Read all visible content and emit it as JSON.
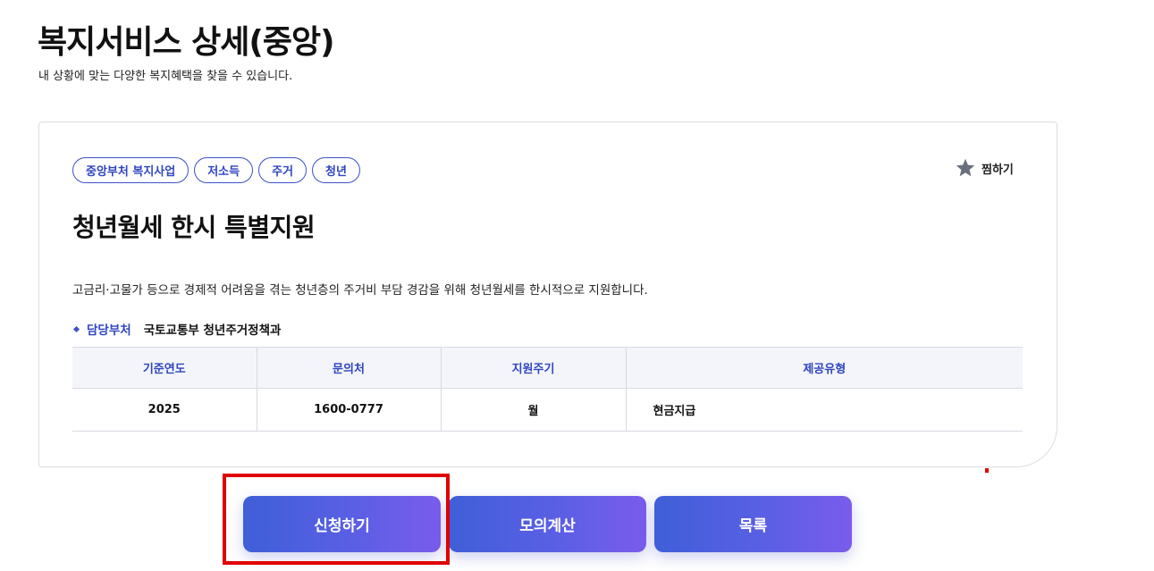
{
  "header": {
    "title": "복지서비스 상세(중앙)",
    "subtitle": "내 상황에 맞는 다양한 복지혜택을 찾을 수 있습니다."
  },
  "service": {
    "tags": [
      "중앙부처 복지사업",
      "저소득",
      "주거",
      "청년"
    ],
    "bookmark_label": "찜하기",
    "title": "청년월세 한시 특별지원",
    "description": "고금리·고물가 등으로 경제적 어려움을 겪는 청년층의 주거비 부담 경감을 위해 청년월세를 한시적으로 지원합니다.",
    "department": {
      "label": "담당부처",
      "value": "국토교통부 청년주거정책과"
    }
  },
  "info_table": {
    "headers": [
      "기준연도",
      "문의처",
      "지원주기",
      "제공유형"
    ],
    "row": [
      "2025",
      "1600-0777",
      "월",
      "현금지급"
    ]
  },
  "actions": {
    "apply": "신청하기",
    "mock_calc": "모의계산",
    "list": "목록"
  },
  "colors": {
    "accent": "#2e45c0",
    "highlight": "#e00000",
    "button_gradient_start": "#3f5fd8",
    "button_gradient_end": "#7a5cec"
  }
}
